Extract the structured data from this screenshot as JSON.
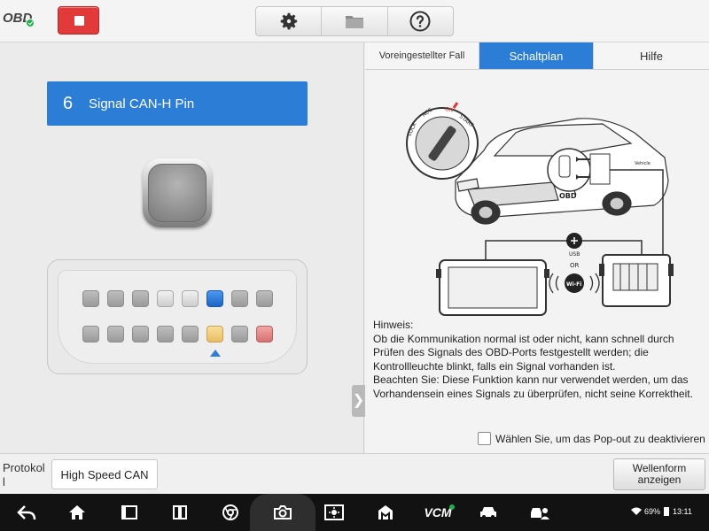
{
  "topbar": {
    "logo": "OBD",
    "connection_status_color": "#22b14c",
    "stop_color": "#e23a3a",
    "tools": [
      "gear-icon",
      "folder-icon",
      "help-icon"
    ]
  },
  "left": {
    "pin_number": "6",
    "pin_label": "Signal CAN-H Pin",
    "accent": "#2b7dd6",
    "led_state": "off",
    "active_pin": 6
  },
  "tabs": [
    "Voreingestellter Fall",
    "Schaltplan",
    "Hilfe"
  ],
  "active_tab": "Schaltplan",
  "diagram": {
    "key_labels": [
      "LOCK",
      "ACC",
      "ON",
      "START"
    ],
    "vehicle_label": "Vehicle",
    "obd_label": "OBD",
    "usb_label": "USB",
    "or_label": "OR",
    "wifi_label": "Wi-Fi"
  },
  "hint": {
    "title": "Hinweis:",
    "text1": "Ob die Kommunikation normal ist oder nicht, kann schnell durch Prüfen des Signals des OBD-Ports festgestellt werden; die Kontrollleuchte blinkt, falls ein Signal vorhanden ist.",
    "text2": "Beachten Sie: Diese Funktion kann nur verwendet werden, um das Vorhandensein eines Signals zu überprüfen, nicht seine Korrektheit."
  },
  "popout": {
    "label": "Wählen Sie, um das Pop-out zu deaktivieren",
    "checked": false
  },
  "bottom": {
    "protokoll_label": "Protokol l",
    "protokoll_value": "High Speed CAN",
    "wave_button": "Wellenform anzeigen"
  },
  "navbar": {
    "vcm_label": "VCM",
    "battery": "69%",
    "time": "13:11"
  }
}
